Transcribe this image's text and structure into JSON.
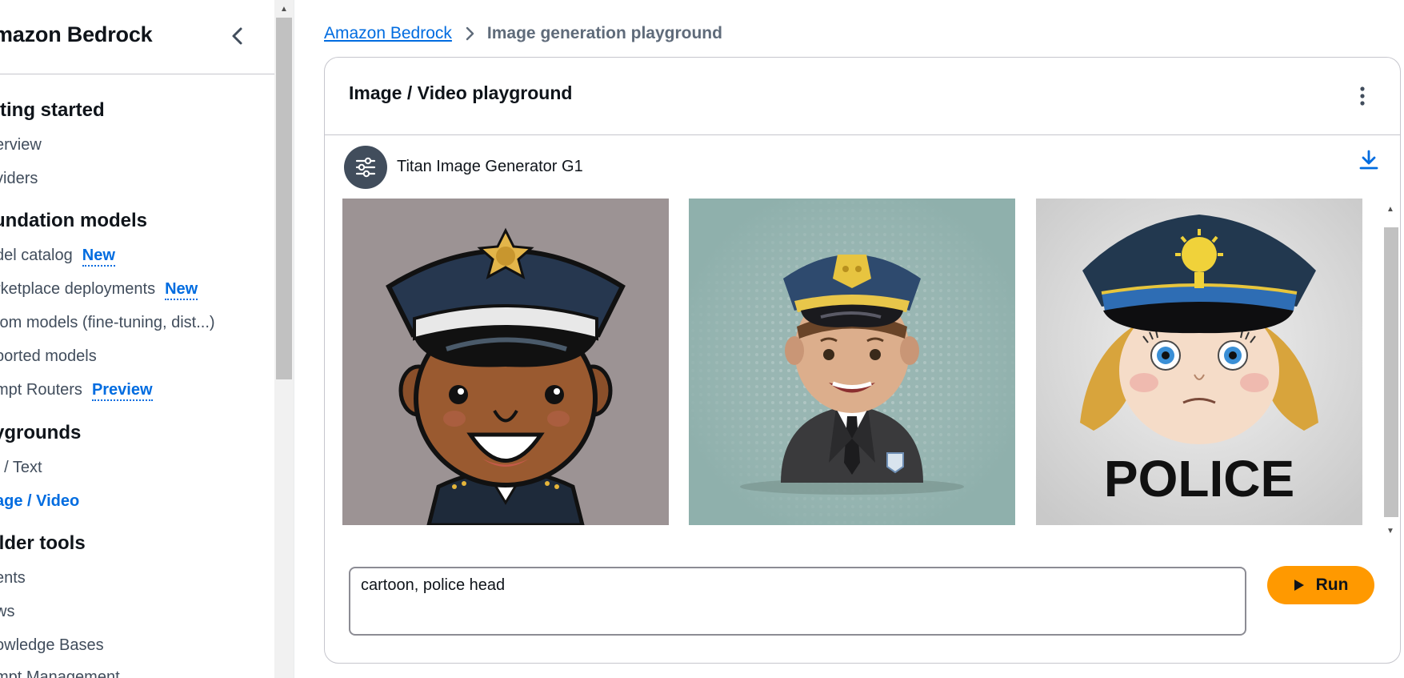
{
  "sidebar": {
    "brand": "mazon Bedrock",
    "sections": [
      {
        "title": "tting started",
        "items": [
          {
            "label": "erview"
          },
          {
            "label": "viders"
          }
        ]
      },
      {
        "title": "undation models",
        "items": [
          {
            "label": "del catalog",
            "badge": "New"
          },
          {
            "label": "rketplace deployments",
            "badge": "New"
          },
          {
            "label": "tom models (fine-tuning, dist...)"
          },
          {
            "label": "ported models"
          },
          {
            "label": "mpt Routers",
            "badge": "Preview"
          }
        ]
      },
      {
        "title": "ygrounds",
        "items": [
          {
            "label": "t / Text"
          },
          {
            "label": "age / Video",
            "active": true
          }
        ]
      },
      {
        "title": "ilder tools",
        "items": [
          {
            "label": "ents"
          },
          {
            "label": "ws"
          },
          {
            "label": "owledge Bases"
          },
          {
            "label": "mpt Management"
          }
        ]
      }
    ]
  },
  "breadcrumb": {
    "root": "Amazon Bedrock",
    "current": "Image generation playground"
  },
  "card": {
    "title": "Image / Video playground",
    "model": "Titan Image Generator G1"
  },
  "prompt": {
    "value": "cartoon, police head"
  },
  "run_label": "Run",
  "images": [
    {
      "name": "generated-image-1",
      "desc": "cartoon policeman with cap"
    },
    {
      "name": "generated-image-2",
      "desc": "cartoon police officer in suit"
    },
    {
      "name": "generated-image-3",
      "desc": "cartoon police girl",
      "text": "POLICE"
    }
  ],
  "colors": {
    "accent": "#006ce0",
    "run": "#ff9900",
    "text": "#0f141a"
  }
}
